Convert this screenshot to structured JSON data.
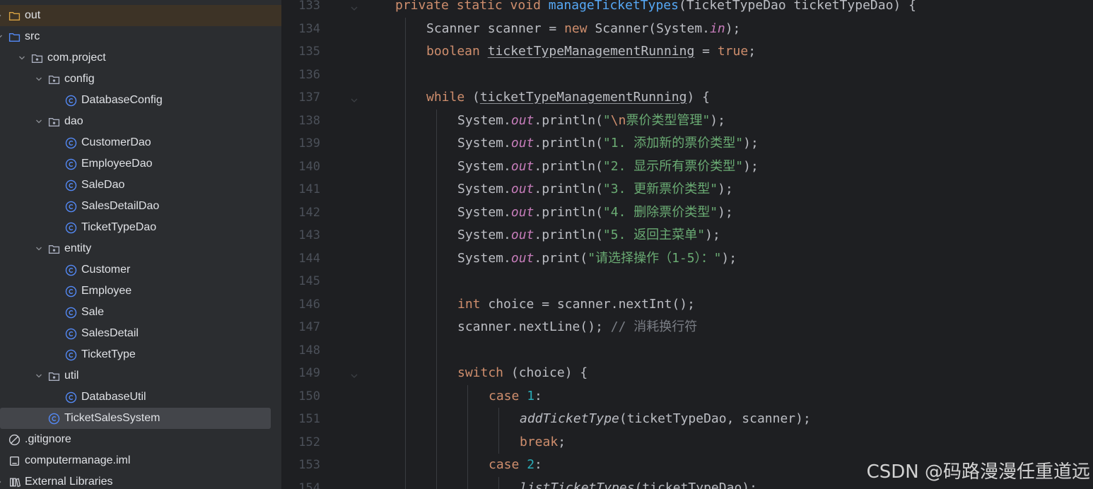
{
  "project_tree": {
    "items": [
      {
        "label": "out",
        "icon": "folder-icon",
        "kind": "folder-excluded",
        "chevron": "right",
        "highlight": "out"
      },
      {
        "label": "src",
        "icon": "folder-icon",
        "kind": "folder-source",
        "chevron": "down"
      },
      {
        "label": "com.project",
        "icon": "package-icon",
        "kind": "package",
        "chevron": "down"
      },
      {
        "label": "config",
        "icon": "package-icon",
        "kind": "package",
        "chevron": "down"
      },
      {
        "label": "DatabaseConfig",
        "icon": "class-icon",
        "kind": "class"
      },
      {
        "label": "dao",
        "icon": "package-icon",
        "kind": "package",
        "chevron": "down"
      },
      {
        "label": "CustomerDao",
        "icon": "class-icon",
        "kind": "class"
      },
      {
        "label": "EmployeeDao",
        "icon": "class-icon",
        "kind": "class"
      },
      {
        "label": "SaleDao",
        "icon": "class-icon",
        "kind": "class"
      },
      {
        "label": "SalesDetailDao",
        "icon": "class-icon",
        "kind": "class"
      },
      {
        "label": "TicketTypeDao",
        "icon": "class-icon",
        "kind": "class"
      },
      {
        "label": "entity",
        "icon": "package-icon",
        "kind": "package",
        "chevron": "down"
      },
      {
        "label": "Customer",
        "icon": "class-icon",
        "kind": "class"
      },
      {
        "label": "Employee",
        "icon": "class-icon",
        "kind": "class"
      },
      {
        "label": "Sale",
        "icon": "class-icon",
        "kind": "class"
      },
      {
        "label": "SalesDetail",
        "icon": "class-icon",
        "kind": "class"
      },
      {
        "label": "TicketType",
        "icon": "class-icon",
        "kind": "class"
      },
      {
        "label": "util",
        "icon": "package-icon",
        "kind": "package",
        "chevron": "down"
      },
      {
        "label": "DatabaseUtil",
        "icon": "class-icon",
        "kind": "class"
      },
      {
        "label": "TicketSalesSystem",
        "icon": "class-icon",
        "kind": "class",
        "highlight": "selected"
      },
      {
        "label": ".gitignore",
        "icon": "ignore-file-icon",
        "kind": "ignore"
      },
      {
        "label": "computermanage.iml",
        "icon": "module-file-icon",
        "kind": "file"
      },
      {
        "label": "External Libraries",
        "icon": "library-icon",
        "kind": "library",
        "chevron": "right"
      }
    ]
  },
  "editor": {
    "lines": [
      {
        "num": "133",
        "tokens": [
          [
            "kw",
            "private static void "
          ],
          [
            "fn",
            "manageTicketTypes"
          ],
          [
            "",
            "(TicketTypeDao ticketTypeDao) {"
          ]
        ]
      },
      {
        "num": "134",
        "tokens": [
          [
            "",
            "Scanner scanner = "
          ],
          [
            "kw",
            "new "
          ],
          [
            "",
            "Scanner(System."
          ],
          [
            "fld",
            "in"
          ],
          [
            "",
            ");"
          ]
        ]
      },
      {
        "num": "135",
        "tokens": [
          [
            "kw",
            "boolean "
          ],
          [
            "ul",
            "ticketTypeManagementRunning"
          ],
          [
            "",
            " = "
          ],
          [
            "kw",
            "true"
          ],
          [
            "",
            ";"
          ]
        ]
      },
      {
        "num": "136",
        "tokens": []
      },
      {
        "num": "137",
        "tokens": [
          [
            "kw",
            "while "
          ],
          [
            "",
            "("
          ],
          [
            "ul",
            "ticketTypeManagementRunning"
          ],
          [
            "",
            ") {"
          ]
        ]
      },
      {
        "num": "138",
        "tokens": [
          [
            "",
            "System."
          ],
          [
            "fld",
            "out"
          ],
          [
            "",
            ".println("
          ],
          [
            "st",
            "\""
          ],
          [
            "kw",
            "\\n"
          ],
          [
            "st",
            "票价类型管理\""
          ],
          [
            "",
            ");"
          ]
        ]
      },
      {
        "num": "139",
        "tokens": [
          [
            "",
            "System."
          ],
          [
            "fld",
            "out"
          ],
          [
            "",
            ".println("
          ],
          [
            "st",
            "\"1. 添加新的票价类型\""
          ],
          [
            "",
            ");"
          ]
        ]
      },
      {
        "num": "140",
        "tokens": [
          [
            "",
            "System."
          ],
          [
            "fld",
            "out"
          ],
          [
            "",
            ".println("
          ],
          [
            "st",
            "\"2. 显示所有票价类型\""
          ],
          [
            "",
            ");"
          ]
        ]
      },
      {
        "num": "141",
        "tokens": [
          [
            "",
            "System."
          ],
          [
            "fld",
            "out"
          ],
          [
            "",
            ".println("
          ],
          [
            "st",
            "\"3. 更新票价类型\""
          ],
          [
            "",
            ");"
          ]
        ]
      },
      {
        "num": "142",
        "tokens": [
          [
            "",
            "System."
          ],
          [
            "fld",
            "out"
          ],
          [
            "",
            ".println("
          ],
          [
            "st",
            "\"4. 删除票价类型\""
          ],
          [
            "",
            ");"
          ]
        ]
      },
      {
        "num": "143",
        "tokens": [
          [
            "",
            "System."
          ],
          [
            "fld",
            "out"
          ],
          [
            "",
            ".println("
          ],
          [
            "st",
            "\"5. 返回主菜单\""
          ],
          [
            "",
            ");"
          ]
        ]
      },
      {
        "num": "144",
        "tokens": [
          [
            "",
            "System."
          ],
          [
            "fld",
            "out"
          ],
          [
            "",
            ".print("
          ],
          [
            "st",
            "\"请选择操作（1-5）：\""
          ],
          [
            "",
            ");"
          ]
        ]
      },
      {
        "num": "145",
        "tokens": []
      },
      {
        "num": "146",
        "tokens": [
          [
            "kw",
            "int "
          ],
          [
            "",
            "choice = scanner.nextInt();"
          ]
        ]
      },
      {
        "num": "147",
        "tokens": [
          [
            "",
            "scanner.nextLine(); "
          ],
          [
            "cm",
            "// 消耗换行符"
          ]
        ]
      },
      {
        "num": "148",
        "tokens": []
      },
      {
        "num": "149",
        "tokens": [
          [
            "kw",
            "switch "
          ],
          [
            "",
            "(choice) {"
          ]
        ]
      },
      {
        "num": "150",
        "tokens": [
          [
            "kw",
            "case "
          ],
          [
            "nm",
            "1"
          ],
          [
            "",
            ":"
          ]
        ]
      },
      {
        "num": "151",
        "tokens": [
          [
            "it",
            "addTicketType"
          ],
          [
            "",
            "(ticketTypeDao, scanner);"
          ]
        ]
      },
      {
        "num": "152",
        "tokens": [
          [
            "kw",
            "break"
          ],
          [
            "",
            ";"
          ]
        ]
      },
      {
        "num": "153",
        "tokens": [
          [
            "kw",
            "case "
          ],
          [
            "nm",
            "2"
          ],
          [
            "",
            ":"
          ]
        ]
      },
      {
        "num": "154",
        "tokens": [
          [
            "it",
            "listTicketTypes"
          ],
          [
            "",
            "(ticketTypeDao);"
          ]
        ]
      }
    ]
  },
  "watermark": "CSDN @码路漫漫任重道远",
  "colors": {
    "tree_bg": "#2b2d30",
    "editor_bg": "#1e1f22",
    "keyword": "#cf8e6d",
    "method": "#56a8f5",
    "string": "#6aab73",
    "number": "#2aacb8",
    "field": "#c77dbb",
    "comment": "#7a7e85"
  }
}
